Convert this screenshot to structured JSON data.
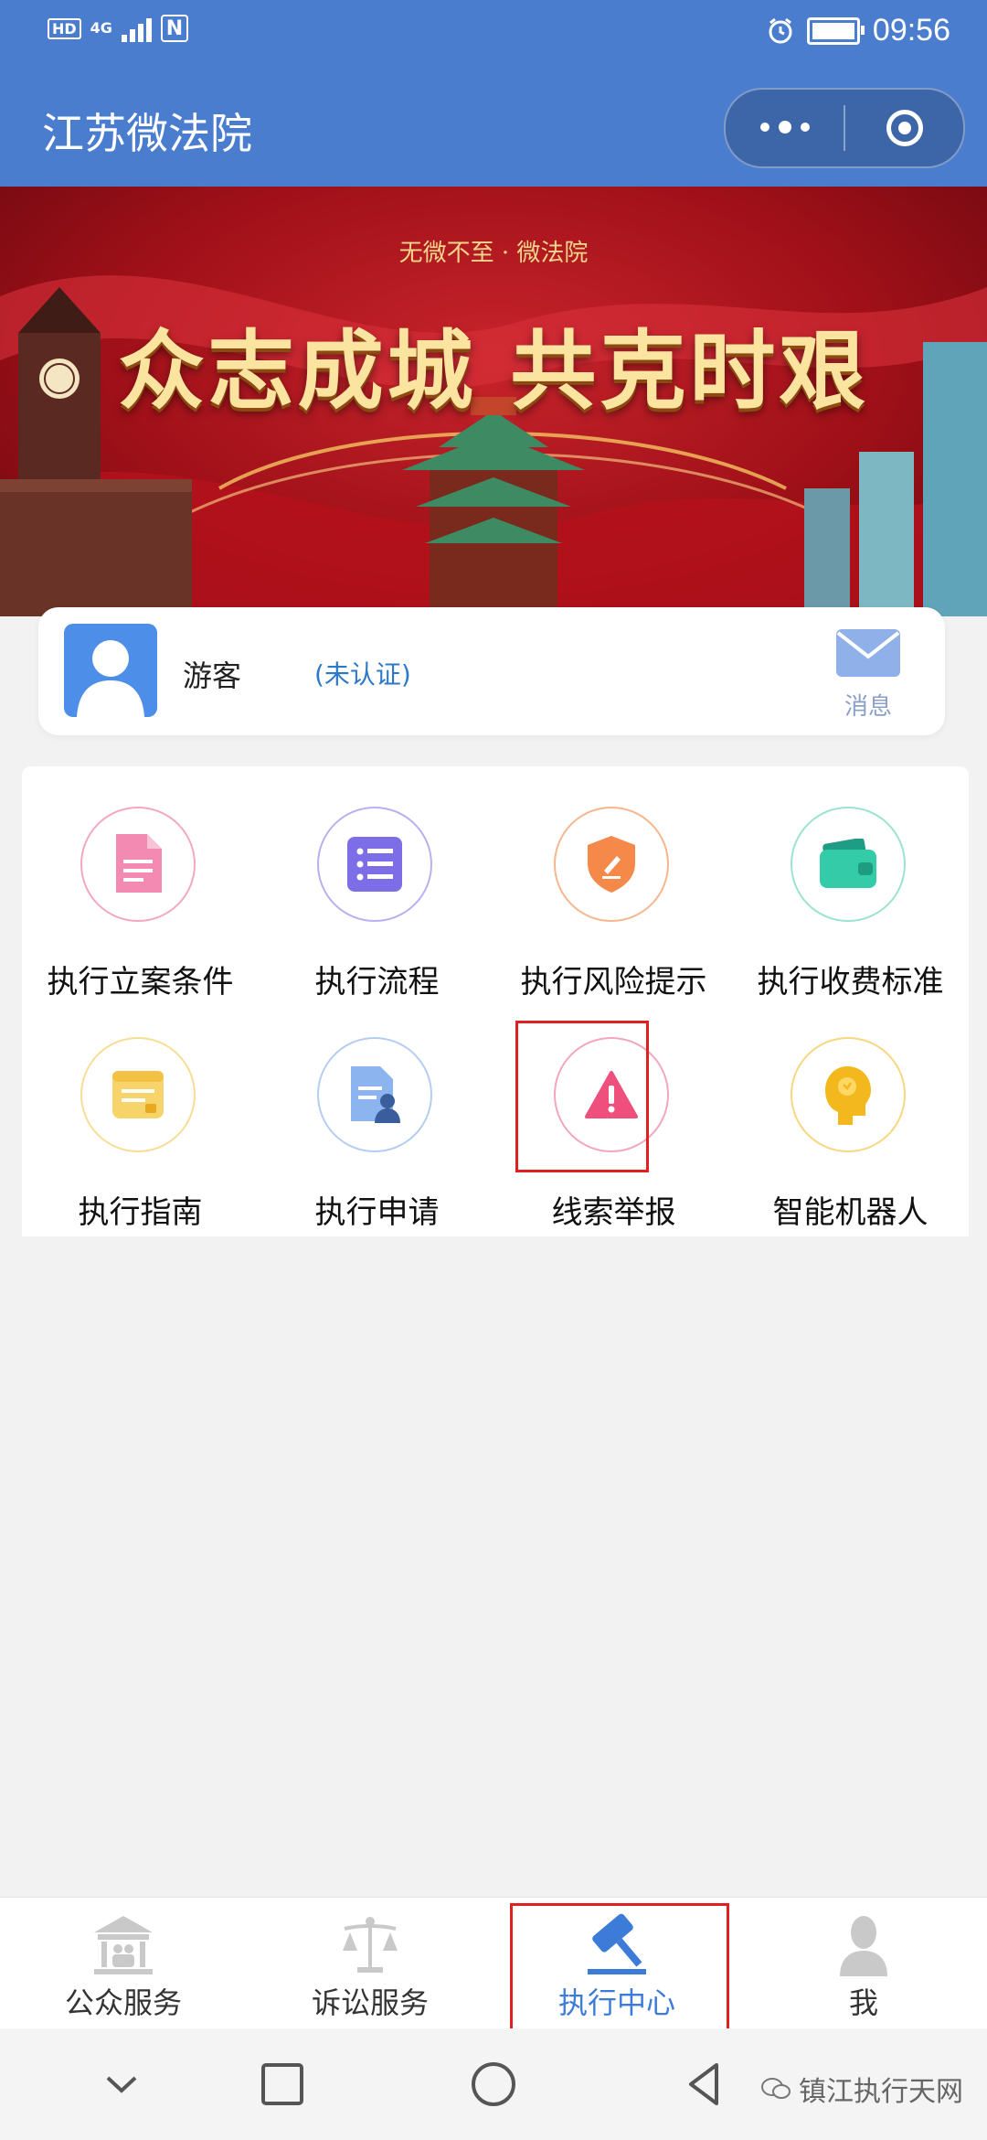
{
  "status_bar": {
    "hd": "HD",
    "network": "4G",
    "nfc": "N",
    "time": "09:56"
  },
  "header": {
    "title": "江苏微法院"
  },
  "banner": {
    "tagline": "无微不至 · 微法院",
    "headline": "众志成城  共克时艰"
  },
  "user": {
    "name": "游客",
    "status": "(未认证)",
    "message_label": "消息"
  },
  "services": [
    {
      "label": "执行立案条件",
      "icon": "document-icon",
      "color": "#f06a9b"
    },
    {
      "label": "执行流程",
      "icon": "checklist-icon",
      "color": "#7c6ee6"
    },
    {
      "label": "执行风险提示",
      "icon": "shield-icon",
      "color": "#f07a3c"
    },
    {
      "label": "执行收费标准",
      "icon": "wallet-icon",
      "color": "#2ec7a4"
    },
    {
      "label": "执行指南",
      "icon": "guide-folder-icon",
      "color": "#f5c84a"
    },
    {
      "label": "执行申请",
      "icon": "application-icon",
      "color": "#6b9ee6"
    },
    {
      "label": "线索举报",
      "icon": "warning-icon",
      "color": "#ef4c7a"
    },
    {
      "label": "智能机器人",
      "icon": "robot-head-icon",
      "color": "#f2b81c"
    }
  ],
  "tabs": [
    {
      "label": "公众服务",
      "icon": "courthouse-icon"
    },
    {
      "label": "诉讼服务",
      "icon": "scales-icon"
    },
    {
      "label": "执行中心",
      "icon": "gavel-icon"
    },
    {
      "label": "我",
      "icon": "person-icon"
    }
  ],
  "active_tab": "执行中心",
  "watermark": "镇江执行天网",
  "colors": {
    "header_blue": "#4b7dcf",
    "active_tab": "#3d7bd9",
    "highlight_red": "#e02020"
  }
}
